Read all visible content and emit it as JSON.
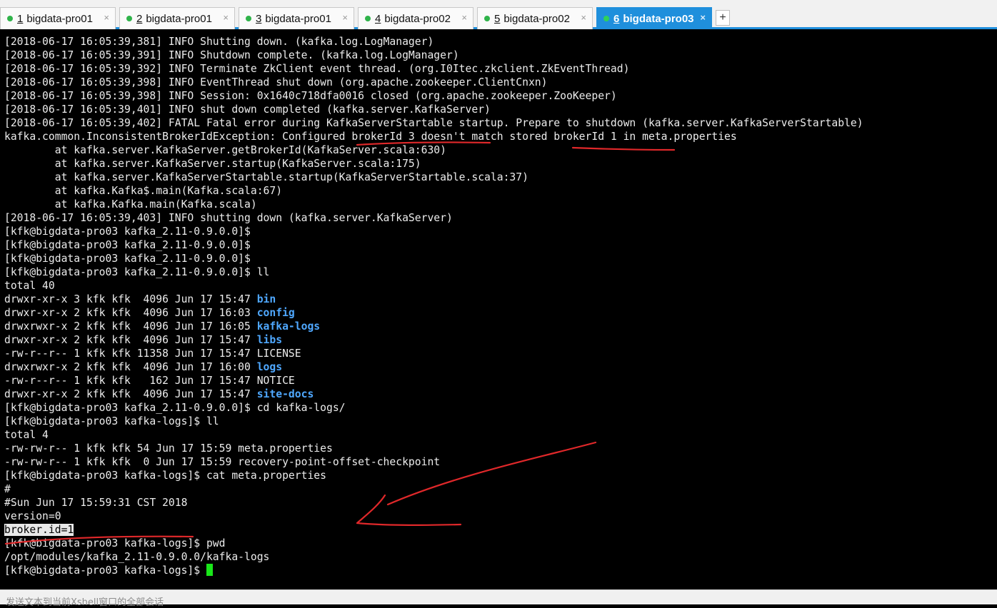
{
  "tabs": [
    {
      "num": "1",
      "label": "bigdata-pro01"
    },
    {
      "num": "2",
      "label": "bigdata-pro01"
    },
    {
      "num": "3",
      "label": "bigdata-pro01"
    },
    {
      "num": "4",
      "label": "bigdata-pro02"
    },
    {
      "num": "5",
      "label": "bigdata-pro02"
    },
    {
      "num": "6",
      "label": "bigdata-pro03"
    }
  ],
  "tab_close": "×",
  "add_tab": "+",
  "colors": {
    "accent": "#1f8fdc",
    "annotation": "#e0282a",
    "cursor": "#19e619",
    "directory": "#4fa8ff"
  },
  "terminal": {
    "lines": [
      "[2018-06-17 16:05:39,381] INFO Shutting down. (kafka.log.LogManager)",
      "[2018-06-17 16:05:39,391] INFO Shutdown complete. (kafka.log.LogManager)",
      "[2018-06-17 16:05:39,392] INFO Terminate ZkClient event thread. (org.I0Itec.zkclient.ZkEventThread)",
      "[2018-06-17 16:05:39,398] INFO EventThread shut down (org.apache.zookeeper.ClientCnxn)",
      "[2018-06-17 16:05:39,398] INFO Session: 0x1640c718dfa0016 closed (org.apache.zookeeper.ZooKeeper)",
      "[2018-06-17 16:05:39,401] INFO shut down completed (kafka.server.KafkaServer)",
      "[2018-06-17 16:05:39,402] FATAL Fatal error during KafkaServerStartable startup. Prepare to shutdown (kafka.server.KafkaServerStartable)",
      "kafka.common.InconsistentBrokerIdException: Configured brokerId 3 doesn't match stored brokerId 1 in meta.properties",
      "        at kafka.server.KafkaServer.getBrokerId(KafkaServer.scala:630)",
      "        at kafka.server.KafkaServer.startup(KafkaServer.scala:175)",
      "        at kafka.server.KafkaServerStartable.startup(KafkaServerStartable.scala:37)",
      "        at kafka.Kafka$.main(Kafka.scala:67)",
      "        at kafka.Kafka.main(Kafka.scala)",
      "[2018-06-17 16:05:39,403] INFO shutting down (kafka.server.KafkaServer)",
      "[kfk@bigdata-pro03 kafka_2.11-0.9.0.0]$",
      "[kfk@bigdata-pro03 kafka_2.11-0.9.0.0]$",
      "[kfk@bigdata-pro03 kafka_2.11-0.9.0.0]$",
      "[kfk@bigdata-pro03 kafka_2.11-0.9.0.0]$ ll",
      "total 40"
    ],
    "listing": [
      {
        "prefix": "drwxr-xr-x 3 kfk kfk  4096 Jun 17 15:47 ",
        "name": "bin",
        "dir": true
      },
      {
        "prefix": "drwxr-xr-x 2 kfk kfk  4096 Jun 17 16:03 ",
        "name": "config",
        "dir": true
      },
      {
        "prefix": "drwxrwxr-x 2 kfk kfk  4096 Jun 17 16:05 ",
        "name": "kafka-logs",
        "dir": true
      },
      {
        "prefix": "drwxr-xr-x 2 kfk kfk  4096 Jun 17 15:47 ",
        "name": "libs",
        "dir": true
      },
      {
        "prefix": "-rw-r--r-- 1 kfk kfk 11358 Jun 17 15:47 ",
        "name": "LICENSE",
        "dir": false
      },
      {
        "prefix": "drwxrwxr-x 2 kfk kfk  4096 Jun 17 16:00 ",
        "name": "logs",
        "dir": true
      },
      {
        "prefix": "-rw-r--r-- 1 kfk kfk   162 Jun 17 15:47 ",
        "name": "NOTICE",
        "dir": false
      },
      {
        "prefix": "drwxr-xr-x 2 kfk kfk  4096 Jun 17 15:47 ",
        "name": "site-docs",
        "dir": true
      }
    ],
    "lines2": [
      "[kfk@bigdata-pro03 kafka_2.11-0.9.0.0]$ cd kafka-logs/",
      "[kfk@bigdata-pro03 kafka-logs]$ ll",
      "total 4",
      "-rw-rw-r-- 1 kfk kfk 54 Jun 17 15:59 meta.properties",
      "-rw-rw-r-- 1 kfk kfk  0 Jun 17 15:59 recovery-point-offset-checkpoint",
      "[kfk@bigdata-pro03 kafka-logs]$ cat meta.properties",
      "#",
      "#Sun Jun 17 15:59:31 CST 2018",
      "version=0"
    ],
    "highlighted": "broker.id=1",
    "lines3": [
      "[kfk@bigdata-pro03 kafka-logs]$ pwd",
      "/opt/modules/kafka_2.11-0.9.0.0/kafka-logs"
    ],
    "prompt": "[kfk@bigdata-pro03 kafka-logs]$ "
  },
  "send_bar": "发送文本到当前Xshell窗口的全部会话"
}
